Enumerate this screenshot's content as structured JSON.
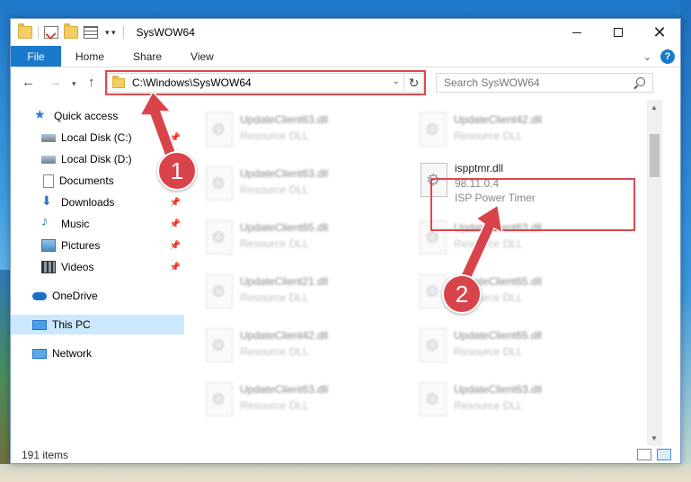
{
  "window": {
    "title": "SysWOW64",
    "controls": {
      "minimize": "—",
      "maximize": "☐",
      "close": "✕"
    }
  },
  "ribbon": {
    "tabs": [
      "File",
      "Home",
      "Share",
      "View"
    ],
    "help": "?",
    "expand_chevron": "⌄"
  },
  "address": {
    "path": "C:\\Windows\\SysWOW64",
    "search_placeholder": "Search SysWOW64"
  },
  "sidebar": {
    "items": [
      {
        "label": "Quick access",
        "icon": "star-icon",
        "pinned": false,
        "selected": false
      },
      {
        "label": "Local Disk (C:)",
        "icon": "disk-icon",
        "pinned": true,
        "selected": false
      },
      {
        "label": "Local Disk (D:)",
        "icon": "disk-icon",
        "pinned": false,
        "selected": false
      },
      {
        "label": "Documents",
        "icon": "document-icon",
        "pinned": false,
        "selected": false
      },
      {
        "label": "Downloads",
        "icon": "download-icon",
        "pinned": true,
        "selected": false
      },
      {
        "label": "Music",
        "icon": "music-icon",
        "pinned": true,
        "selected": false
      },
      {
        "label": "Pictures",
        "icon": "pictures-icon",
        "pinned": true,
        "selected": false
      },
      {
        "label": "Videos",
        "icon": "videos-icon",
        "pinned": true,
        "selected": false
      },
      {
        "label": "OneDrive",
        "icon": "cloud-icon",
        "pinned": false,
        "selected": false
      },
      {
        "label": "This PC",
        "icon": "computer-icon",
        "pinned": false,
        "selected": true
      },
      {
        "label": "Network",
        "icon": "network-icon",
        "pinned": false,
        "selected": false
      }
    ]
  },
  "files": {
    "left_column": [
      {
        "name": "UpdateClient63.dll",
        "type": "Resource DLL"
      },
      {
        "name": "UpdateClient63.dll",
        "type": "Resource DLL"
      },
      {
        "name": "UpdateClient65.dll",
        "type": "Resource DLL"
      },
      {
        "name": "UpdateClient21.dll",
        "type": "Resource DLL"
      },
      {
        "name": "UpdateClient42.dll",
        "type": "Resource DLL"
      },
      {
        "name": "UpdateClient63.dll",
        "type": "Resource DLL"
      }
    ],
    "right_column": [
      {
        "name": "UpdateClient42.dll",
        "type": "Resource DLL"
      },
      {
        "name": "ispptmr.dll",
        "version": "98.11.0.4",
        "type": "ISP Power Timer",
        "highlighted": true
      },
      {
        "name": "UpdateClient63.dll",
        "type": "Resource DLL"
      },
      {
        "name": "UpdateClient65.dll",
        "type": "Resource DLL"
      },
      {
        "name": "UpdateClient65.dll",
        "type": "Resource DLL"
      },
      {
        "name": "UpdateClient63.dll",
        "type": "Resource DLL"
      }
    ]
  },
  "status": {
    "item_count": "191 items"
  },
  "annotations": {
    "badge1": "1",
    "badge2": "2",
    "color": "#d9444b"
  }
}
